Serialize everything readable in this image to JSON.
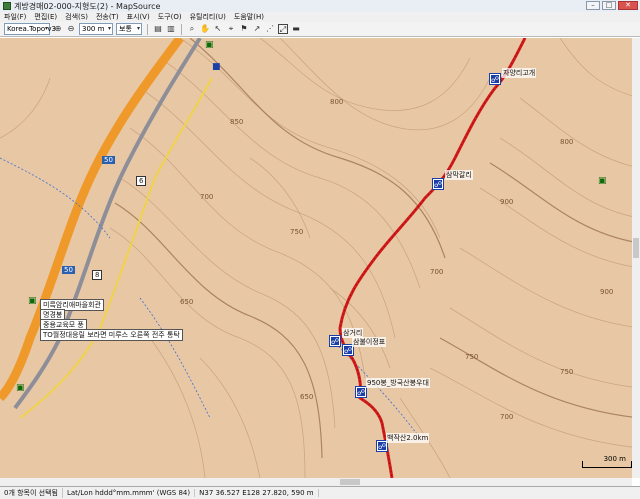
{
  "window": {
    "title": "계방경매02-000-지형도(2) - MapSource"
  },
  "menu": [
    {
      "label": "파일(F)"
    },
    {
      "label": "편집(E)"
    },
    {
      "label": "검색(S)"
    },
    {
      "label": "전송(T)"
    },
    {
      "label": "표시(V)"
    },
    {
      "label": "도구(O)"
    },
    {
      "label": "유틸리티(U)"
    },
    {
      "label": "도움말(H)"
    }
  ],
  "toolbar": {
    "map_select": "Korea.Topo v3",
    "zoom_select": "300 m",
    "detail_select": "보통"
  },
  "map": {
    "highway_shields": [
      {
        "label": "50"
      },
      {
        "label": "6"
      },
      {
        "label": "50"
      },
      {
        "label": "8"
      }
    ],
    "contour_labels": [
      {
        "label": "850"
      },
      {
        "label": "800"
      },
      {
        "label": "750"
      },
      {
        "label": "700"
      },
      {
        "label": "900"
      },
      {
        "label": "650"
      },
      {
        "label": "700"
      },
      {
        "label": "800"
      },
      {
        "label": "750"
      },
      {
        "label": "750"
      },
      {
        "label": "650"
      },
      {
        "label": "700"
      },
      {
        "label": "900"
      }
    ],
    "waypoints": [
      {
        "label": "자양리고개"
      },
      {
        "label": "삼막갈리"
      },
      {
        "label": "삼거리"
      },
      {
        "label": "삼불이정표"
      },
      {
        "label": "950봉_방국산봉우대"
      },
      {
        "label": "백작산2.0km"
      }
    ],
    "callouts": [
      {
        "label": "미륵암리애마을회관"
      },
      {
        "label": "명경봉"
      },
      {
        "label": "중용교육모 풍"
      },
      {
        "label": "TO월정대응릴 보라면 미루스 오른쪽 전주 통탁"
      }
    ],
    "scale_label": "300 m"
  },
  "status": {
    "selection": "0개 항목이 선택됨",
    "format": "Lat/Lon hddd°mm.mmm' (WGS 84)",
    "position": "N37 36.527 E128 27.820, 590 m"
  }
}
